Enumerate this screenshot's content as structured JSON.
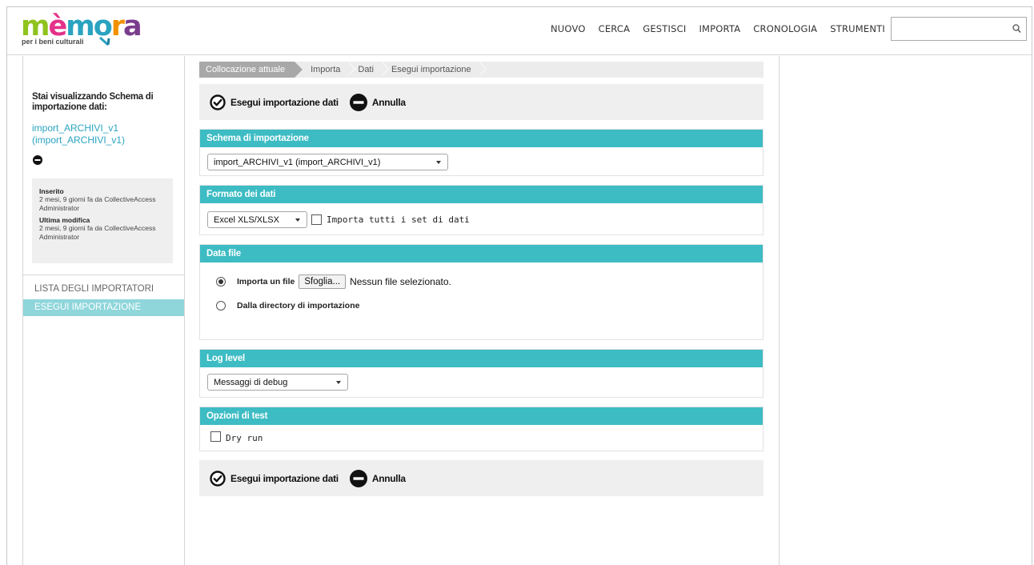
{
  "logo": {
    "word": "mèmora",
    "subtitle": "per i beni culturali"
  },
  "nav": {
    "items": [
      "NUOVO",
      "CERCA",
      "GESTISCI",
      "IMPORTA",
      "CRONOLOGIA",
      "STRUMENTI"
    ]
  },
  "search": {
    "value": "",
    "placeholder": ""
  },
  "sidebar": {
    "title": "Stai visualizzando Schema di importazione dati:",
    "link": "import_ARCHIVI_v1 (import_ARCHIVI_v1)",
    "inserted_label": "Inserito",
    "inserted_value": "2 mesi, 9 giorni fa da CollectiveAccess Administrator",
    "modified_label": "Ultima modifica",
    "modified_value": "2 mesi, 9 giorni fa da CollectiveAccess Administrator",
    "menu": [
      "LISTA DEGLI IMPORTATORI",
      "ESEGUI IMPORTAZIONE"
    ],
    "active_index": 1
  },
  "breadcrumb": [
    "Collocazione attuale",
    "Importa",
    "Dati",
    "Esegui importazione"
  ],
  "actions": {
    "run": "Esegui importazione dati",
    "cancel": "Annulla"
  },
  "panels": {
    "schema": {
      "title": "Schema di importazione",
      "selected": "import_ARCHIVI_v1 (import_ARCHIVI_v1)"
    },
    "format": {
      "title": "Formato dei dati",
      "selected": "Excel XLS/XLSX",
      "checkbox_label": "Importa tutti i set di dati"
    },
    "datafile": {
      "title": "Data file",
      "option_file": "Importa un file",
      "browse": "Sfoglia...",
      "no_file": "Nessun file selezionato.",
      "option_dir": "Dalla directory di importazione"
    },
    "log": {
      "title": "Log level",
      "selected": "Messaggi di debug"
    },
    "test": {
      "title": "Opzioni di test",
      "checkbox_label": "Dry run"
    }
  },
  "colors": {
    "accent": "#3dbcc4",
    "active_menu": "#8fd6db",
    "link": "#2aa3c0"
  }
}
